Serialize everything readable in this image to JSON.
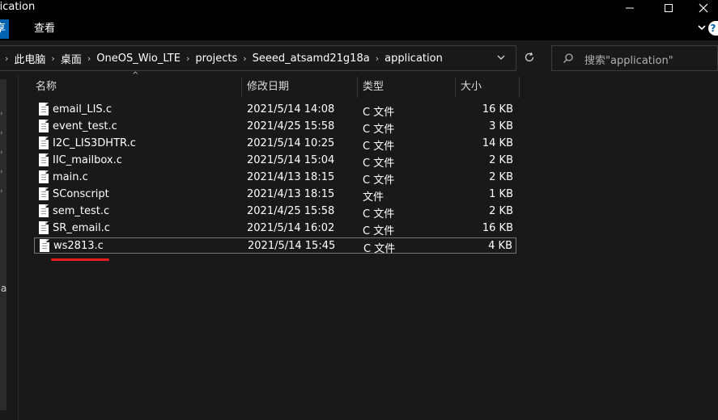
{
  "window": {
    "title": "lication",
    "controls": [
      "minimize-icon",
      "maximize-icon",
      "close-icon"
    ]
  },
  "ribbon": {
    "tabs": [
      {
        "label": "享",
        "active": true
      },
      {
        "label": "查看",
        "active": false
      }
    ]
  },
  "address": {
    "breadcrumbs": [
      "此电脑",
      "桌面",
      "OneOS_Wio_LTE",
      "projects",
      "Seeed_atsamd21g18a",
      "application"
    ]
  },
  "search": {
    "placeholder": "搜索\"application\""
  },
  "columns": {
    "name": "名称",
    "modified": "修改日期",
    "type": "类型",
    "size": "大小"
  },
  "files": [
    {
      "name": "email_LIS.c",
      "modified": "2021/5/14 14:08",
      "type": "C 文件",
      "size": "16 KB"
    },
    {
      "name": "event_test.c",
      "modified": "2021/4/25 15:58",
      "type": "C 文件",
      "size": "3 KB"
    },
    {
      "name": "I2C_LIS3DHTR.c",
      "modified": "2021/5/14 10:25",
      "type": "C 文件",
      "size": "14 KB"
    },
    {
      "name": "IIC_mailbox.c",
      "modified": "2021/5/14 15:04",
      "type": "C 文件",
      "size": "2 KB"
    },
    {
      "name": "main.c",
      "modified": "2021/4/13 18:15",
      "type": "C 文件",
      "size": "2 KB"
    },
    {
      "name": "SConscript",
      "modified": "2021/4/13 18:15",
      "type": "文件",
      "size": "1 KB"
    },
    {
      "name": "sem_test.c",
      "modified": "2021/4/25 15:58",
      "type": "C 文件",
      "size": "2 KB"
    },
    {
      "name": "SR_email.c",
      "modified": "2021/5/14 16:02",
      "type": "C 文件",
      "size": "16 KB"
    },
    {
      "name": "ws2813.c",
      "modified": "2021/5/14 15:45",
      "type": "C 文件",
      "size": "4 KB",
      "selected": true
    }
  ],
  "navpane": {
    "partial_label": "a"
  },
  "colors": {
    "background": "#191919",
    "accent": "#0063b1",
    "underline": "#e81c1c"
  }
}
